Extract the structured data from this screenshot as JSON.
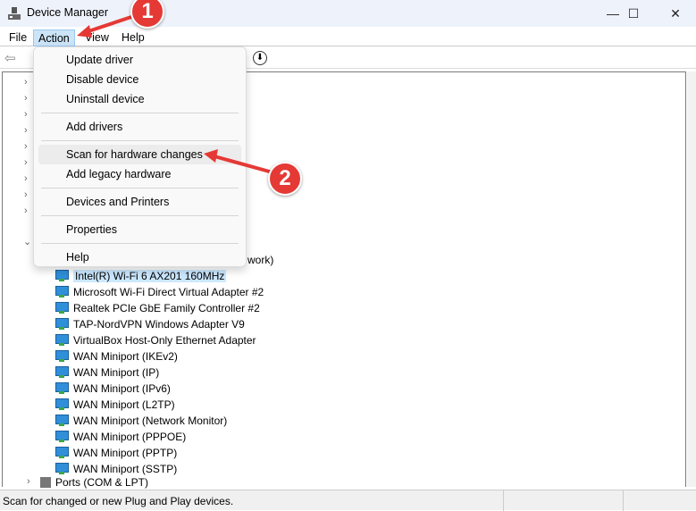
{
  "window": {
    "title": "Device Manager"
  },
  "menubar": [
    "File",
    "Action",
    "View",
    "Help"
  ],
  "action_menu": {
    "items": [
      {
        "label": "Update driver"
      },
      {
        "label": "Disable device"
      },
      {
        "label": "Uninstall device"
      },
      {
        "label": "Add drivers"
      },
      {
        "label": "Scan for hardware changes",
        "highlighted": true
      },
      {
        "label": "Add legacy hardware"
      },
      {
        "label": "Devices and Printers"
      },
      {
        "label": "Properties"
      },
      {
        "label": "Help"
      }
    ]
  },
  "tree": {
    "partial_label": "work)",
    "network_children": [
      "Intel(R) Wi-Fi 6 AX201 160MHz",
      "Microsoft Wi-Fi Direct Virtual Adapter #2",
      "Realtek PCIe GbE Family Controller #2",
      "TAP-NordVPN Windows Adapter V9",
      "VirtualBox Host-Only Ethernet Adapter",
      "WAN Miniport (IKEv2)",
      "WAN Miniport (IP)",
      "WAN Miniport (IPv6)",
      "WAN Miniport (L2TP)",
      "WAN Miniport (Network Monitor)",
      "WAN Miniport (PPPOE)",
      "WAN Miniport (PPTP)",
      "WAN Miniport (SSTP)"
    ],
    "selected": "Intel(R) Wi-Fi 6 AX201 160MHz",
    "next_category": "Ports (COM & LPT)"
  },
  "statusbar": {
    "text": "Scan for changed or new Plug and Play devices."
  },
  "annotations": {
    "step1": "1",
    "step2": "2",
    "color": "#e53935"
  }
}
